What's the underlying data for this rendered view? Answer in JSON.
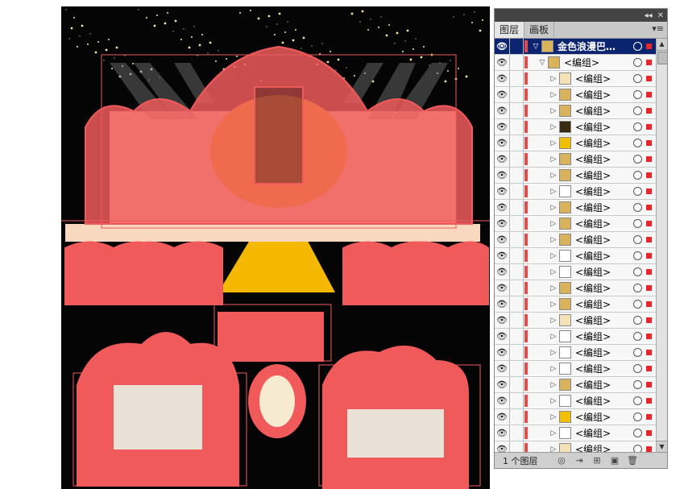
{
  "panel": {
    "top_icons": [
      "collapse-icon",
      "close-icon"
    ],
    "tabs": [
      {
        "label": "图层",
        "active": true
      },
      {
        "label": "画板",
        "active": false
      }
    ],
    "menu_icon": "panel-menu-icon",
    "layer_count": "1 个图层",
    "bottom_icons": [
      "locate-object-icon",
      "make-clipping-mask-icon",
      "new-sublayer-icon",
      "new-layer-icon",
      "delete-icon"
    ]
  },
  "layers": [
    {
      "name": "金色浪漫巴…",
      "level": 0,
      "selected": true,
      "thumb": "gold"
    },
    {
      "name": "<编组>",
      "level": 1,
      "selected": false,
      "thumb": "gold"
    },
    {
      "name": "<编组>",
      "level": 2,
      "selected": false,
      "thumb": "cream"
    },
    {
      "name": "<编组>",
      "level": 2,
      "selected": false,
      "thumb": "gold"
    },
    {
      "name": "<编组>",
      "level": 2,
      "selected": false,
      "thumb": "gold"
    },
    {
      "name": "<编组>",
      "level": 2,
      "selected": false,
      "thumb": "dark"
    },
    {
      "name": "<编组>",
      "level": 2,
      "selected": false,
      "thumb": "yellow"
    },
    {
      "name": "<编组>",
      "level": 2,
      "selected": false,
      "thumb": "gold"
    },
    {
      "name": "<编组>",
      "level": 2,
      "selected": false,
      "thumb": "gold"
    },
    {
      "name": "<编组>",
      "level": 2,
      "selected": false,
      "thumb": "white"
    },
    {
      "name": "<编组>",
      "level": 2,
      "selected": false,
      "thumb": "gold"
    },
    {
      "name": "<编组>",
      "level": 2,
      "selected": false,
      "thumb": "gold"
    },
    {
      "name": "<编组>",
      "level": 2,
      "selected": false,
      "thumb": "gold"
    },
    {
      "name": "<编组>",
      "level": 2,
      "selected": false,
      "thumb": "white"
    },
    {
      "name": "<编组>",
      "level": 2,
      "selected": false,
      "thumb": "white"
    },
    {
      "name": "<编组>",
      "level": 2,
      "selected": false,
      "thumb": "gold"
    },
    {
      "name": "<编组>",
      "level": 2,
      "selected": false,
      "thumb": "gold"
    },
    {
      "name": "<编组>",
      "level": 2,
      "selected": false,
      "thumb": "cream"
    },
    {
      "name": "<编组>",
      "level": 2,
      "selected": false,
      "thumb": "white"
    },
    {
      "name": "<编组>",
      "level": 2,
      "selected": false,
      "thumb": "white"
    },
    {
      "name": "<编组>",
      "level": 2,
      "selected": false,
      "thumb": "white"
    },
    {
      "name": "<编组>",
      "level": 2,
      "selected": false,
      "thumb": "gold"
    },
    {
      "name": "<编组>",
      "level": 2,
      "selected": false,
      "thumb": "white"
    },
    {
      "name": "<编组>",
      "level": 2,
      "selected": false,
      "thumb": "yellow"
    },
    {
      "name": "<编组>",
      "level": 2,
      "selected": false,
      "thumb": "white"
    },
    {
      "name": "<编组>",
      "level": 2,
      "selected": false,
      "thumb": "cream"
    }
  ],
  "colors": {
    "layer_color": "#e84a4a",
    "selection_overlay": "#f05a5a",
    "artboard_bg": "#050505",
    "stage_gold": "#f2c300",
    "stage_cream": "#f6ead0"
  }
}
